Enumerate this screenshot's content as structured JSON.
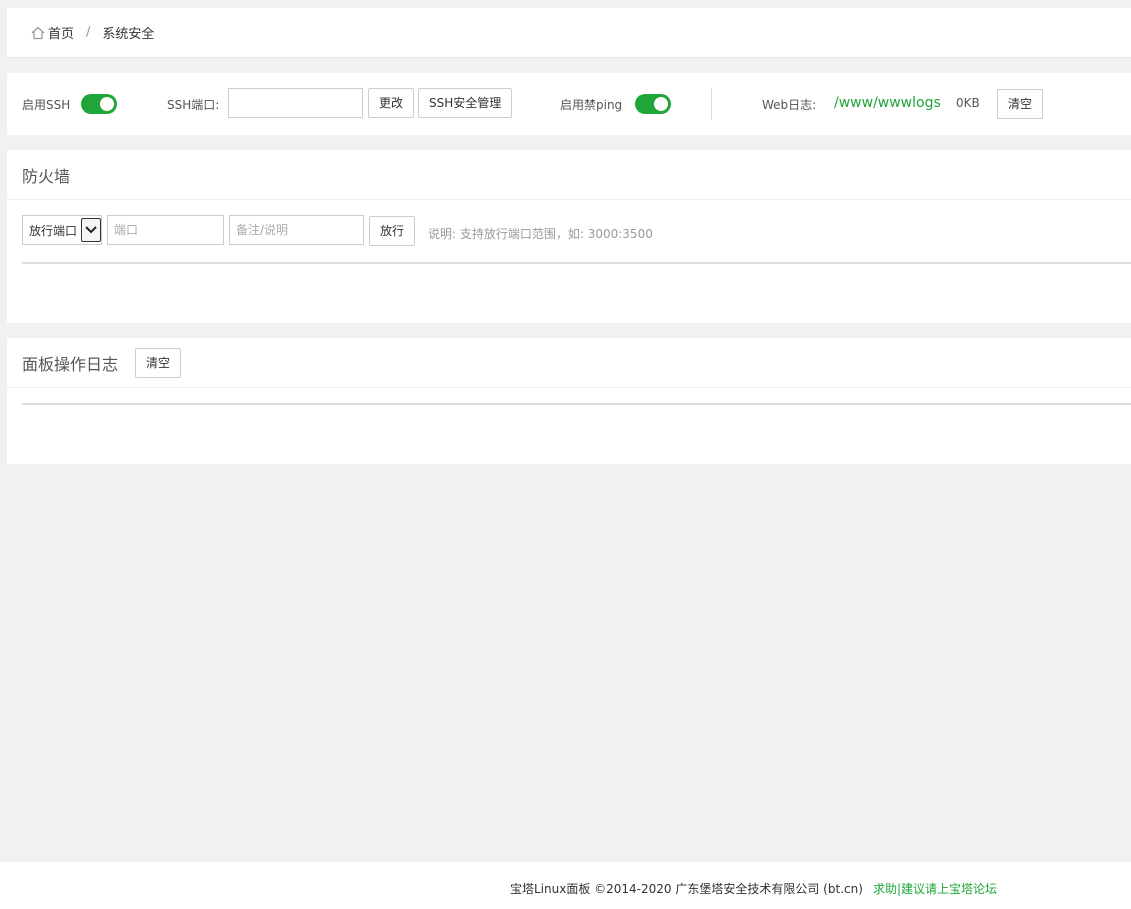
{
  "breadcrumb": {
    "home": "首页",
    "separator": "/",
    "current": "系统安全"
  },
  "ssh": {
    "enable_label": "启用SSH",
    "enable_on": true,
    "port_label": "SSH端口:",
    "port_value": "",
    "change_button": "更改",
    "manage_button": "SSH安全管理",
    "ping_label": "启用禁ping",
    "ping_on": true,
    "weblog_label": "Web日志:",
    "weblog_path": "/www/wwwlogs",
    "weblog_size": "0KB",
    "clear_button": "清空"
  },
  "firewall": {
    "title": "防火墙",
    "select_value": "放行端口",
    "port_placeholder": "端口",
    "remark_placeholder": "备注/说明",
    "allow_button": "放行",
    "hint": "说明: 支持放行端口范围，如: 3000:3500"
  },
  "panel_log": {
    "title": "面板操作日志",
    "clear_button": "清空"
  },
  "footer": {
    "copyright": "宝塔Linux面板 ©2014-2020 广东堡塔安全技术有限公司 (bt.cn)",
    "help_link": "求助|建议请上宝塔论坛"
  },
  "colors": {
    "accent": "#20a53a",
    "background": "#f1f1f1"
  }
}
